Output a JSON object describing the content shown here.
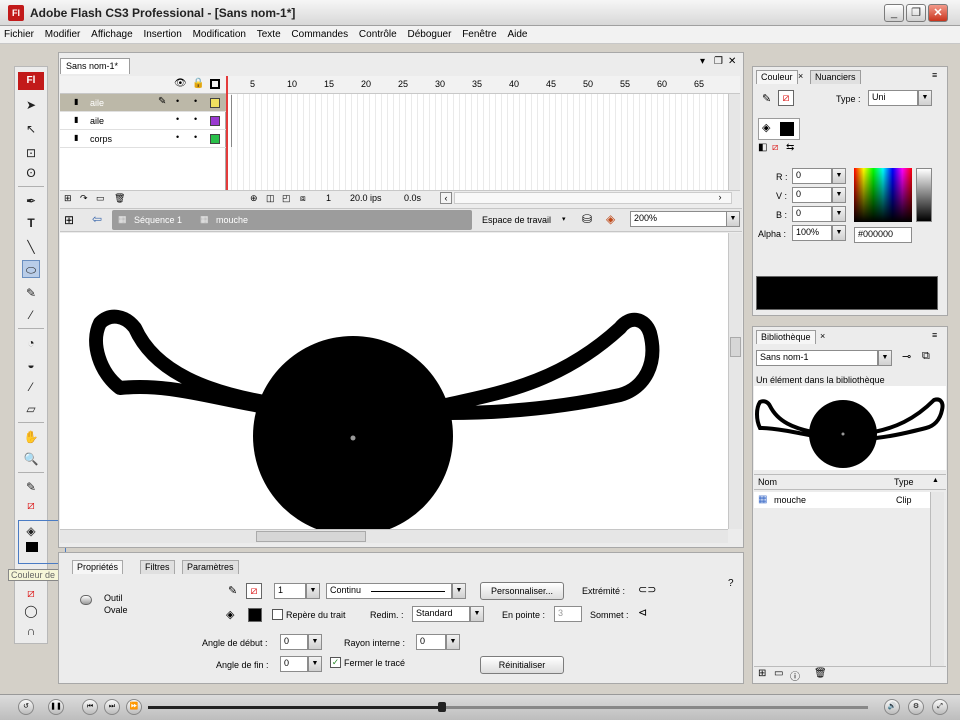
{
  "app": {
    "title": "Adobe Flash CS3 Professional - [Sans nom-1*]",
    "icon": "flash-app-icon",
    "brand_color": "#c21a1a"
  },
  "menubar": [
    "Fichier",
    "Modifier",
    "Affichage",
    "Insertion",
    "Modification",
    "Texte",
    "Commandes",
    "Contrôle",
    "Déboguer",
    "Fenêtre",
    "Aide"
  ],
  "toolbox": {
    "badge": "Fl",
    "tooltip": "Couleur de remplissage"
  },
  "document": {
    "tab_label": "Sans nom-1*"
  },
  "timeline": {
    "frame_numbers": [
      "5",
      "10",
      "15",
      "20",
      "25",
      "30",
      "35",
      "40",
      "45",
      "50",
      "55",
      "60",
      "65"
    ],
    "layers": [
      {
        "name": "aile",
        "selected": true,
        "color": "#f0e060"
      },
      {
        "name": "aile",
        "selected": false,
        "color": "#9a3ad0"
      },
      {
        "name": "corps",
        "selected": false,
        "color": "#2ac04a"
      }
    ],
    "current_frame": "1",
    "fps": "20.0 ips",
    "time": "0.0s"
  },
  "editbar": {
    "scene": "Séquence 1",
    "symbol": "mouche",
    "workspace": "Espace de travail",
    "zoom": "200%"
  },
  "properties": {
    "tabs": [
      "Propriétés",
      "Filtres",
      "Paramètres"
    ],
    "tool_label": "Outil",
    "tool_name": "Ovale",
    "stroke_width": "1",
    "stroke_style": "Continu",
    "customize_button": "Personnaliser...",
    "extremity_label": "Extrémité :",
    "hinting_label": "Repère du trait",
    "scale_label": "Redim. :",
    "scale_value": "Standard",
    "miter_label": "En pointe :",
    "miter_value": "3",
    "join_label": "Sommet :",
    "start_angle_label": "Angle de début :",
    "start_angle_value": "0",
    "inner_radius_label": "Rayon interne :",
    "inner_radius_value": "0",
    "end_angle_label": "Angle de fin :",
    "end_angle_value": "0",
    "close_path_label": "Fermer le tracé",
    "close_path_checked": true,
    "reset_button": "Réinitialiser"
  },
  "color_panel": {
    "tabs": [
      "Couleur",
      "Nuanciers"
    ],
    "type_label": "Type :",
    "type_value": "Uni",
    "r_label": "R :",
    "r_value": "0",
    "v_label": "V :",
    "v_value": "0",
    "b_label": "B :",
    "b_value": "0",
    "alpha_label": "Alpha :",
    "alpha_value": "100%",
    "hex_value": "#000000"
  },
  "library": {
    "tab": "Bibliothèque",
    "document": "Sans nom-1",
    "count_text": "Un élément dans la bibliothèque",
    "col_name": "Nom",
    "col_type": "Type",
    "items": [
      {
        "name": "mouche",
        "type": "Clip"
      }
    ]
  }
}
